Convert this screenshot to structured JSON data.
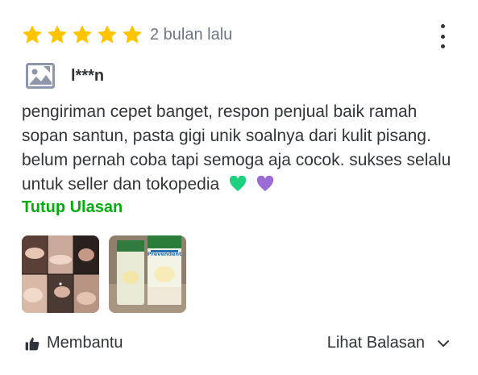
{
  "review": {
    "rating": 5,
    "max_rating": 5,
    "time_ago": "2 bulan lalu",
    "menu_icon": "more-vertical-icon",
    "user": {
      "avatar_icon": "image-placeholder-icon",
      "name": "l***n"
    },
    "text": "pengiriman cepet banget, respon penjual baik ramah sopan santun, pasta gigi unik soalnya dari kulit pisang. belum pernah coba tapi semoga aja cocok. sukses selalu untuk seller dan tokopedia",
    "emojis": [
      "green-heart-icon",
      "purple-heart-icon"
    ],
    "collapse_label": "Tutup Ulasan",
    "images": [
      {
        "name": "review-photo-1"
      },
      {
        "name": "review-photo-2",
        "product_brand": "Prevendent"
      }
    ],
    "helpful_label": "Membantu",
    "replies_label": "Lihat Balasan"
  },
  "colors": {
    "star": "#ffc400",
    "accent_green": "#03ac0e",
    "text": "#31353b",
    "muted": "#6d7588",
    "heart_green": "#1ed07f",
    "heart_purple": "#9b6bd6"
  }
}
